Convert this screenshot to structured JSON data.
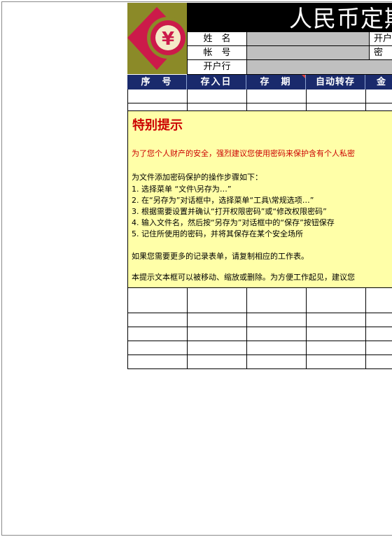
{
  "form": {
    "title": "人民币定期存款",
    "logo_symbol": "¥",
    "labels": {
      "name": "姓　名",
      "account": "帐　号",
      "bank": "开户行",
      "open_right": "开户",
      "password_right": "密"
    },
    "columns": [
      "序　号",
      "存入日",
      "存　期",
      "自动转存",
      "金"
    ]
  },
  "note": {
    "title": "特别提示",
    "warning": "为了您个人财产的安全，强烈建议您使用密码来保护含有个人私密",
    "steps_intro": "为文件添加密码保护的操作步骤如下：",
    "steps": [
      "1. 选择菜单 “文件\\另存为…”",
      "2. 在“另存为”对话框中，选择菜单“工具\\常规选项…”",
      "3. 根据需要设置并确认“打开权限密码”或“修改权限密码”",
      "4. 输入文件名，然后按“另存为”对话框中的“保存”按钮保存",
      "5. 记住所使用的密码，并将其保存在某个安全场所"
    ],
    "copy_tip": "如果您需要更多的记录表单，请复制相应的工作表。",
    "move_tip": "本提示文本框可以被移动、缩放或删除。为方便工作起见，建议您"
  },
  "colors": {
    "header_bg": "#1a2a6c",
    "note_bg": "#ffffa8",
    "logo_bg": "#8b8a28",
    "logo_red": "#cc1a4a",
    "warning_red": "#cc0000"
  }
}
